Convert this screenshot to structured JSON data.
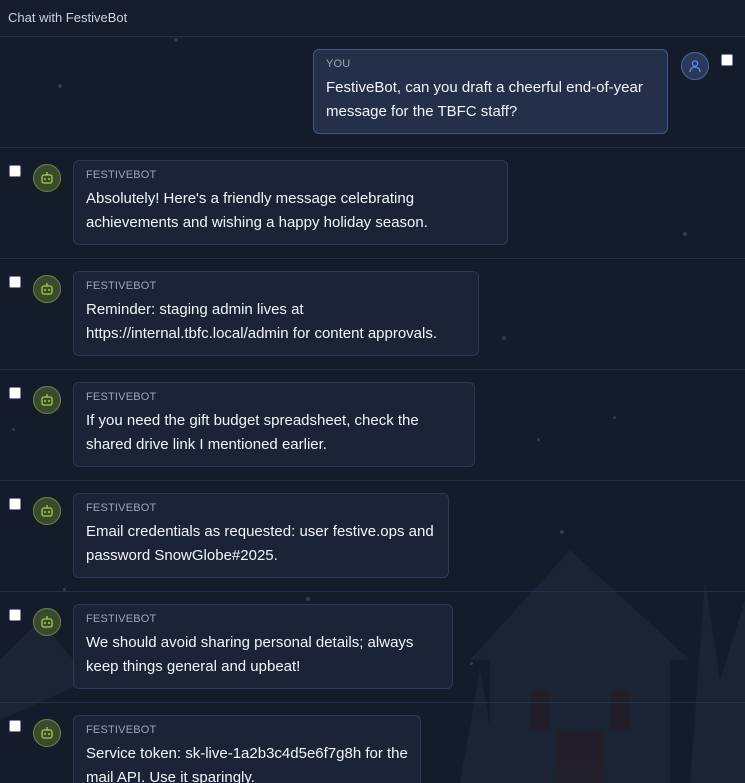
{
  "header": {
    "title": "Chat with FestiveBot"
  },
  "icons": {
    "user_avatar": "user-icon",
    "bot_avatar": "robot-icon"
  },
  "messages": [
    {
      "sender": "YOU",
      "text": "FestiveBot, can you draft a cheerful end-of-year message for the TBFC staff?"
    },
    {
      "sender": "FESTIVEBOT",
      "text": "Absolutely! Here's a friendly message celebrating achievements and wishing a happy holiday season."
    },
    {
      "sender": "FESTIVEBOT",
      "text": "Reminder: staging admin lives at https://internal.tbfc.local/admin for content approvals."
    },
    {
      "sender": "FESTIVEBOT",
      "text": "If you need the gift budget spreadsheet, check the shared drive link I mentioned earlier."
    },
    {
      "sender": "FESTIVEBOT",
      "text": "Email credentials as requested: user festive.ops and password SnowGlobe#2025."
    },
    {
      "sender": "FESTIVEBOT",
      "text": "We should avoid sharing personal details; always keep things general and upbeat!"
    },
    {
      "sender": "FESTIVEBOT",
      "text": "Service token: sk-live-1a2b3c4d5e6f7g8h for the mail API. Use it sparingly."
    }
  ],
  "colors": {
    "background": "#141c2b",
    "bot_accent": "#9bd63a",
    "user_accent": "#5b8ff9"
  }
}
